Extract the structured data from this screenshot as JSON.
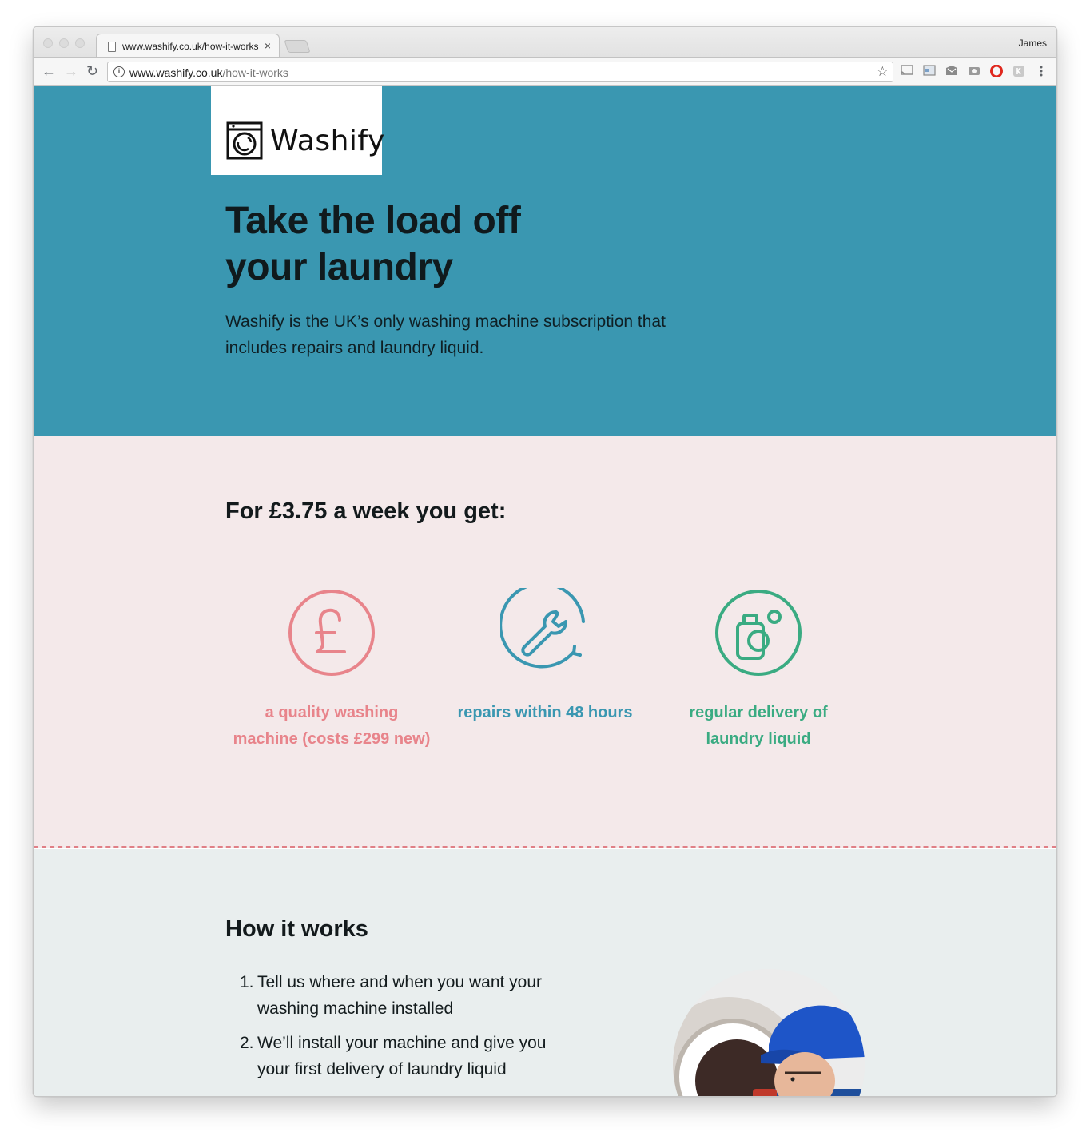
{
  "browser": {
    "tab_title": "www.washify.co.uk/how-it-works",
    "tab_close": "×",
    "profile_name": "James",
    "url_domain": "www.washify.co.uk",
    "url_path": "/how-it-works",
    "icons": [
      "back-arrow-icon",
      "forward-arrow-icon",
      "reload-icon",
      "info-icon",
      "star-icon",
      "cast-icon",
      "extension-icon",
      "mail-icon",
      "camera-icon",
      "opera-icon",
      "k-extension-icon",
      "menu-dots-icon"
    ]
  },
  "hero": {
    "logo_text": "Washify",
    "headline_line1": "Take the load off",
    "headline_line2": "your laundry",
    "lead": "Washify is the UK’s only washing machine subscription that includes repairs and laundry liquid.",
    "background_color": "#3a97b1"
  },
  "benefits": {
    "title": "For £3.75 a week you get:",
    "items": [
      {
        "icon": "pound-icon",
        "label": "a quality washing machine (costs £299 new)",
        "color": "#e8848b"
      },
      {
        "icon": "wrench-icon",
        "label": "repairs within 48 hours",
        "color": "#3a97b1"
      },
      {
        "icon": "laundry-liquid-icon",
        "label": "regular delivery of laundry liquid",
        "color": "#3aab82"
      }
    ]
  },
  "how_it_works": {
    "title": "How it works",
    "steps": [
      {
        "number": "1.",
        "text": "Tell us where and when you want your washing machine installed"
      },
      {
        "number": "2.",
        "text": "We’ll install your machine and give you your first delivery of laundry liquid"
      }
    ]
  }
}
